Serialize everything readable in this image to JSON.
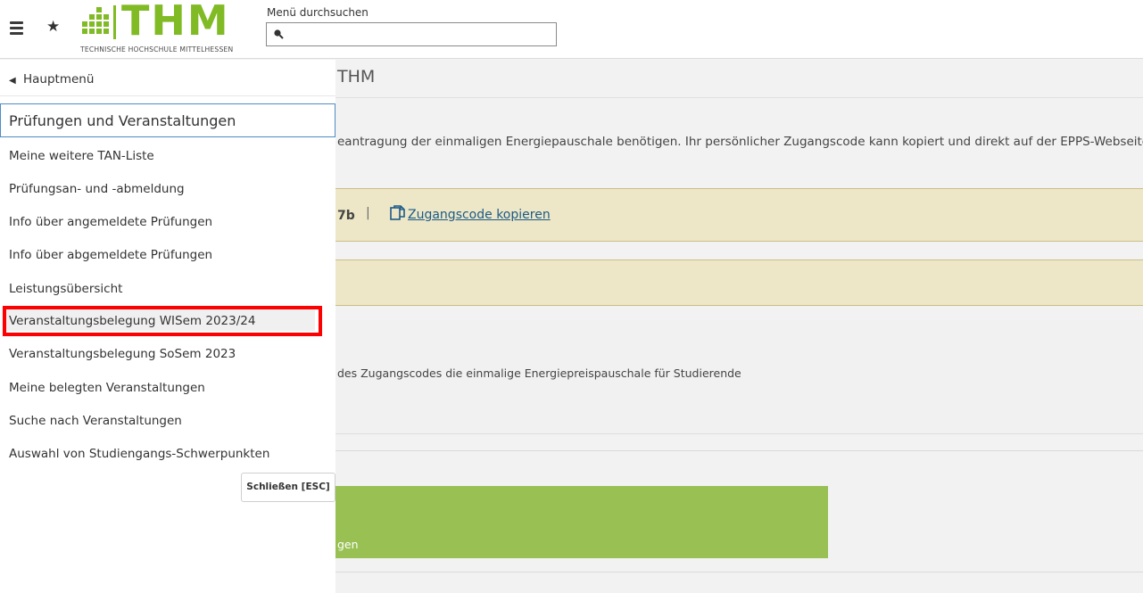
{
  "header": {
    "logo_text": "THM",
    "logo_subtitle": "TECHNISCHE HOCHSCHULE MITTELHESSEN",
    "search_label": "Menü durchsuchen",
    "search_value": ""
  },
  "page": {
    "title": "THM",
    "info_text": "eantragung der einmaligen Energiepauschale benötigen. Ihr persönlicher Zugangscode kann kopiert und direkt auf der EPPS-Webseite w",
    "code_partial": "7b",
    "code_separator": "|",
    "copy_link": "Zugangscode kopieren",
    "panel_text": "des Zugangscodes die einmalige Energiepreispauschale für Studierende",
    "green_text": "gen"
  },
  "menu": {
    "back_label": "Hauptmenü",
    "section_title": "Prüfungen und Veranstaltungen",
    "items": [
      "Meine weitere TAN-Liste",
      "Prüfungsan- und -abmeldung",
      "Info über angemeldete Prüfungen",
      "Info über abgemeldete Prüfungen",
      "Leistungsübersicht",
      "Veranstaltungsbelegung WISem 2023/24",
      "Veranstaltungsbelegung SoSem 2023",
      "Meine belegten Veranstaltungen",
      "Suche nach Veranstaltungen",
      "Auswahl von Studiengangs-Schwerpunkten"
    ],
    "close_label": "Schließen [ESC]"
  },
  "colors": {
    "brand_green": "#80ba24",
    "highlight_red": "#ff0000",
    "notice_bg": "#ede7c7",
    "section_border": "#4f8bc2"
  },
  "icons": [
    "hamburger-icon",
    "star-icon",
    "search-icon",
    "copy-icon",
    "chevron-left-icon"
  ]
}
